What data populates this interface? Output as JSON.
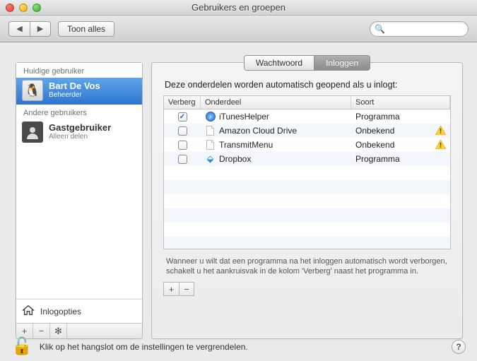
{
  "window": {
    "title": "Gebruikers en groepen"
  },
  "toolbar": {
    "show_all": "Toon alles",
    "search_placeholder": ""
  },
  "sidebar": {
    "current_header": "Huidige gebruiker",
    "other_header": "Andere gebruikers",
    "current": {
      "name": "Bart De Vos",
      "role": "Beheerder"
    },
    "others": [
      {
        "name": "Gastgebruiker",
        "role": "Alleen delen"
      }
    ],
    "login_options": "Inlogopties"
  },
  "tabs": {
    "password": "Wachtwoord",
    "login": "Inloggen"
  },
  "intro": "Deze onderdelen worden automatisch geopend als u inlogt:",
  "columns": {
    "hide": "Verberg",
    "item": "Onderdeel",
    "kind": "Soort"
  },
  "items": [
    {
      "hidden": true,
      "icon": "itunes",
      "name": "iTunesHelper",
      "kind": "Programma",
      "warn": false
    },
    {
      "hidden": false,
      "icon": "doc",
      "name": "Amazon Cloud Drive",
      "kind": "Onbekend",
      "warn": true
    },
    {
      "hidden": false,
      "icon": "doc",
      "name": "TransmitMenu",
      "kind": "Onbekend",
      "warn": true
    },
    {
      "hidden": false,
      "icon": "dropbox",
      "name": "Dropbox",
      "kind": "Programma",
      "warn": false
    }
  ],
  "hint": "Wanneer u wilt dat een programma na het inloggen automatisch wordt verborgen, schakelt u het aankruisvak in de kolom 'Verberg' naast het programma in.",
  "lock_text": "Klik op het hangslot om de instellingen te vergrendelen."
}
